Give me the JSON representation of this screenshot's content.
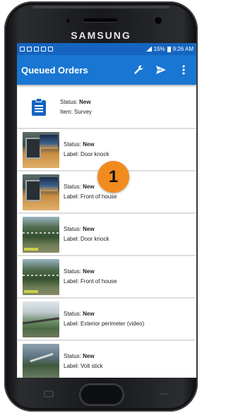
{
  "device": {
    "brand": "SAMSUNG"
  },
  "status_bar": {
    "battery": "15%",
    "time": "9:26 AM"
  },
  "appbar": {
    "title": "Queued Orders",
    "icons": [
      "wrench-icon",
      "send-icon",
      "more-vert-icon"
    ],
    "color": "#1976d2"
  },
  "labels": {
    "status": "Status: ",
    "item": "Item: ",
    "label": "Label: "
  },
  "orders": [
    {
      "status": "New",
      "item": "Survey",
      "icon": "clipboard-icon"
    },
    {
      "status": "New",
      "label": "Door knock",
      "thumbnail": "office-photo"
    },
    {
      "status": "New",
      "label": "Front of house",
      "thumbnail": "office-photo"
    },
    {
      "status": "New",
      "label": "Door knock",
      "thumbnail": "yard-photo"
    },
    {
      "status": "New",
      "label": "Front of house",
      "thumbnail": "yard-photo"
    },
    {
      "status": "New",
      "label": "Exterior perimeter (video)",
      "thumbnail": "fence-photo"
    },
    {
      "status": "New",
      "label": "Volt stick",
      "thumbnail": "stick-photo"
    }
  ],
  "annotation_badge": {
    "text": "1",
    "color": "#f28b1e"
  }
}
